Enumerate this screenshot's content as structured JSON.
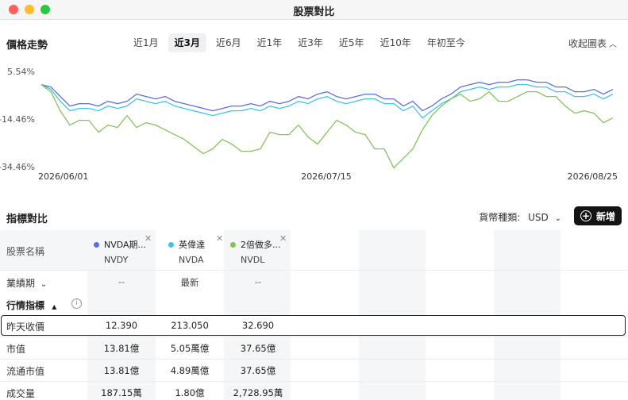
{
  "window": {
    "title": "股票對比"
  },
  "price_trend": {
    "title": "價格走勢",
    "range_tabs": [
      "近1月",
      "近3月",
      "近6月",
      "近1年",
      "近3年",
      "近5年",
      "近10年",
      "年初至今"
    ],
    "active_tab": "近3月",
    "collapse_label": "收起圖表"
  },
  "chart_data": {
    "type": "line",
    "ylim": [
      -34.46,
      5.54
    ],
    "yticks": [
      "5.54%",
      "-14.46%",
      "-34.46%"
    ],
    "xticks": [
      "2026/06/01",
      "2026/07/15",
      "2026/08/25"
    ],
    "grid": false,
    "series": [
      {
        "name": "NVDA期...",
        "color": "#5b6fe0",
        "values": [
          0,
          -1,
          -5,
          -9,
          -8,
          -8,
          -9,
          -7,
          -8,
          -7,
          -4,
          -5,
          -6,
          -5,
          -7,
          -8,
          -9,
          -10,
          -11,
          -10,
          -9,
          -9,
          -8,
          -9,
          -7,
          -8,
          -7,
          -5,
          -6,
          -4,
          -3,
          -5,
          -6,
          -5,
          -4,
          -4,
          -6,
          -6,
          -9,
          -7,
          -11,
          -9,
          -6,
          -4,
          -1,
          0,
          1,
          0,
          1,
          1,
          2,
          2,
          1,
          1,
          -1,
          -1,
          -3,
          -3,
          -2,
          -4,
          -2
        ]
      },
      {
        "name": "英偉達",
        "color": "#3cc6e3",
        "values": [
          0,
          -2,
          -7,
          -11,
          -10,
          -10,
          -11,
          -9,
          -10,
          -9,
          -6,
          -7,
          -8,
          -7,
          -9,
          -10,
          -11,
          -12,
          -13,
          -12,
          -11,
          -11,
          -10,
          -11,
          -9,
          -10,
          -9,
          -7,
          -8,
          -6,
          -5,
          -7,
          -8,
          -7,
          -6,
          -6,
          -8,
          -8,
          -11,
          -9,
          -14,
          -11,
          -8,
          -6,
          -3,
          -2,
          -1,
          -2,
          -1,
          -1,
          0,
          0,
          -1,
          -1,
          -3,
          -3,
          -5,
          -5,
          -4,
          -6,
          -4
        ]
      },
      {
        "name": "2倍做多...",
        "color": "#84c25a",
        "values": [
          0,
          -3,
          -11,
          -17,
          -15,
          -15,
          -20,
          -17,
          -18,
          -13,
          -18,
          -16,
          -17,
          -19,
          -21,
          -23,
          -26,
          -29,
          -27,
          -23,
          -25,
          -28,
          -28,
          -27,
          -20,
          -21,
          -21,
          -17,
          -22,
          -25,
          -20,
          -15,
          -17,
          -20,
          -21,
          -27,
          -27,
          -35,
          -31,
          -27,
          -19,
          -13,
          -9,
          -6,
          -4,
          -7,
          -6,
          -3,
          -7,
          -7,
          -5,
          -3,
          -3,
          -5,
          -5,
          -9,
          -12,
          -11,
          -12,
          -16,
          -14
        ]
      }
    ]
  },
  "metrics": {
    "title": "指標對比",
    "currency_label": "貨幣種類:",
    "currency_value": "USD",
    "add_label": "新增",
    "stock_name_label": "股票名稱",
    "stocks": [
      {
        "name": "NVDA期...",
        "code": "NVDY",
        "color": "#5b6fe0"
      },
      {
        "name": "英偉達",
        "code": "NVDA",
        "color": "#3cc6e3"
      },
      {
        "name": "2倍做多...",
        "code": "NVDL",
        "color": "#84c25a"
      }
    ],
    "period_label": "業績期",
    "period_values": [
      "--",
      "最新",
      "--"
    ],
    "market_section_label": "行情指標",
    "rows": [
      {
        "label": "昨天收價",
        "values": [
          "12.390",
          "213.050",
          "32.690"
        ]
      },
      {
        "label": "市值",
        "values": [
          "13.81億",
          "5.05萬億",
          "37.65億"
        ]
      },
      {
        "label": "流通市值",
        "values": [
          "13.81億",
          "4.89萬億",
          "37.65億"
        ]
      },
      {
        "label": "成交量",
        "values": [
          "187.15萬",
          "1.80億",
          "2,728.95萬"
        ]
      }
    ]
  }
}
